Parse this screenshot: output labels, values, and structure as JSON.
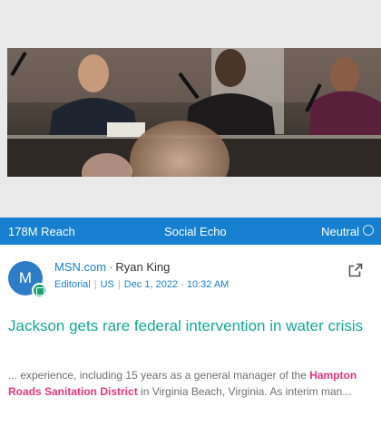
{
  "stats": {
    "reach": "178M Reach",
    "echo": "Social Echo",
    "sentiment": "Neutral"
  },
  "article": {
    "avatar_letter": "M",
    "source": "MSN.com",
    "separator": "·",
    "author": "Ryan King",
    "type": "Editorial",
    "country": "US",
    "date": "Dec 1, 2022 · 10:32 AM",
    "headline": "Jackson gets rare federal intervention in water crisis",
    "snippet_before": "... experience, including 15 years as a general manager of the ",
    "snippet_highlight": "Hampton Roads Sanitation District",
    "snippet_after": " in Virginia Beach, Virginia. As interim man..."
  },
  "colors": {
    "accent_blue": "#1780d0",
    "headline_teal": "#13a897",
    "highlight_pink": "#e8347e"
  }
}
